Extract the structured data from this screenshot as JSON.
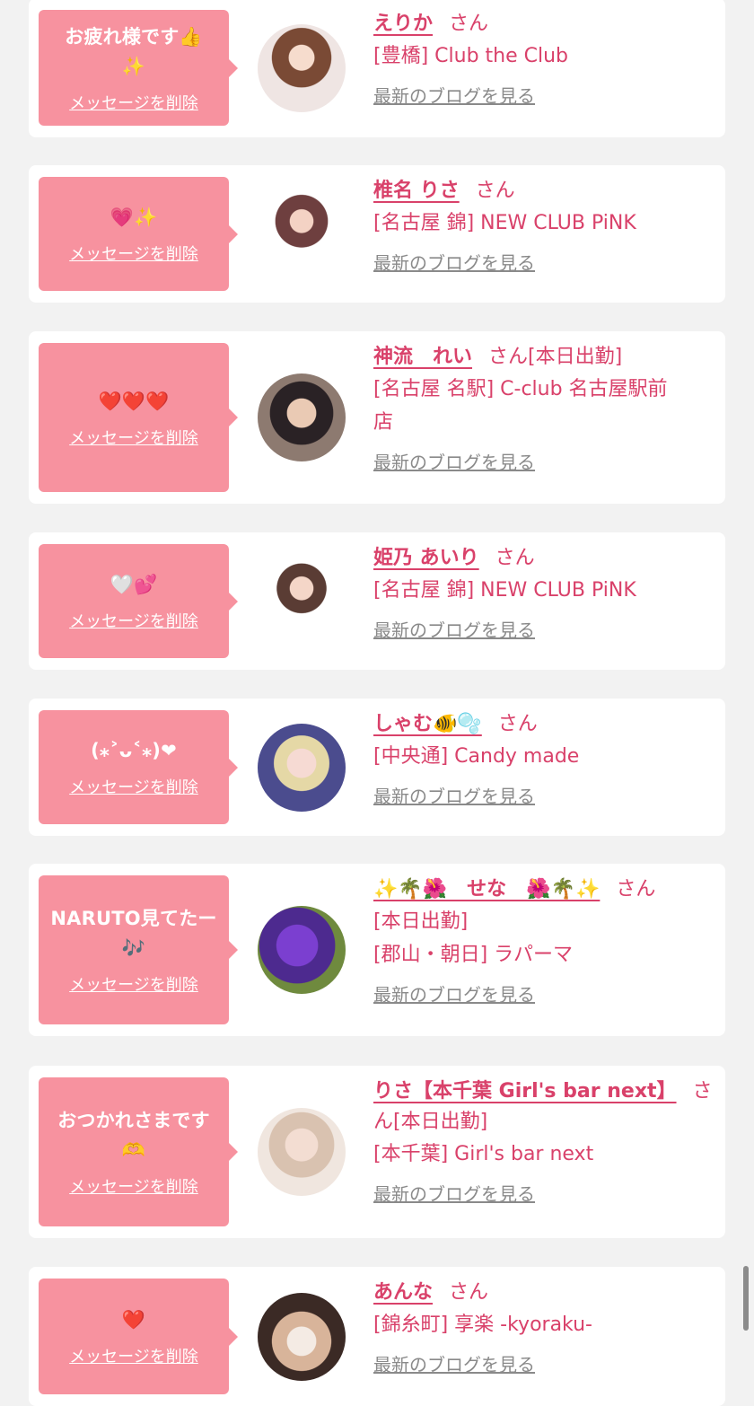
{
  "common": {
    "delete_label": "メッセージを削除",
    "blog_label": "最新のブログを見る",
    "honorific": "さん",
    "accent_color": "#d9416a",
    "bubble_color": "#f7929f"
  },
  "messages": [
    {
      "message_lines": [
        "お疲れ様です👍",
        "✨"
      ],
      "name": "えりか",
      "status": "",
      "shop_lines": [
        "[豊橋] Club the Club"
      ],
      "avatar_icon": "woman-portrait-icon"
    },
    {
      "message_lines": [
        "💗✨"
      ],
      "name": "椎名 りさ",
      "status": "",
      "shop_lines": [
        "[名古屋 錦] NEW CLUB PiNK"
      ],
      "avatar_icon": "woman-portrait-icon"
    },
    {
      "message_lines": [
        "❤️❤️❤️"
      ],
      "name": "神流　れい",
      "status": "[本日出勤]",
      "shop_lines": [
        "[名古屋 名駅] C-club 名古屋駅前",
        "店"
      ],
      "avatar_icon": "woman-portrait-icon"
    },
    {
      "message_lines": [
        "🤍💕"
      ],
      "name": "姫乃 あいり",
      "status": "",
      "shop_lines": [
        "[名古屋 錦] NEW CLUB PiNK"
      ],
      "avatar_icon": "woman-portrait-icon"
    },
    {
      "message_lines": [
        "(⁎˃ᴗ˂⁎)❤"
      ],
      "name": "しゃむ🐠🫧",
      "status": "",
      "shop_lines": [
        "[中央通] Candy made"
      ],
      "avatar_icon": "woman-portrait-icon"
    },
    {
      "message_lines": [
        "NARUTO見てたー",
        "🎶"
      ],
      "name": "✨🌴🌺　せな　🌺🌴✨",
      "status": "",
      "shop_lines": [
        "[本日出勤]",
        "[郡山・朝日] ラパーマ"
      ],
      "avatar_icon": "purple-flower-icon"
    },
    {
      "message_lines": [
        "おつかれさまです",
        "🫶"
      ],
      "name": "りさ【本千葉 Girl's bar next】",
      "status": "[本日出勤]",
      "shop_lines": [
        "[本千葉] Girl's bar next"
      ],
      "avatar_icon": "woman-portrait-icon"
    },
    {
      "message_lines": [
        "❤️"
      ],
      "name": "あんな",
      "status": "",
      "shop_lines": [
        "[錦糸町] 享楽 -kyoraku-"
      ],
      "avatar_icon": "woman-portrait-icon"
    }
  ]
}
